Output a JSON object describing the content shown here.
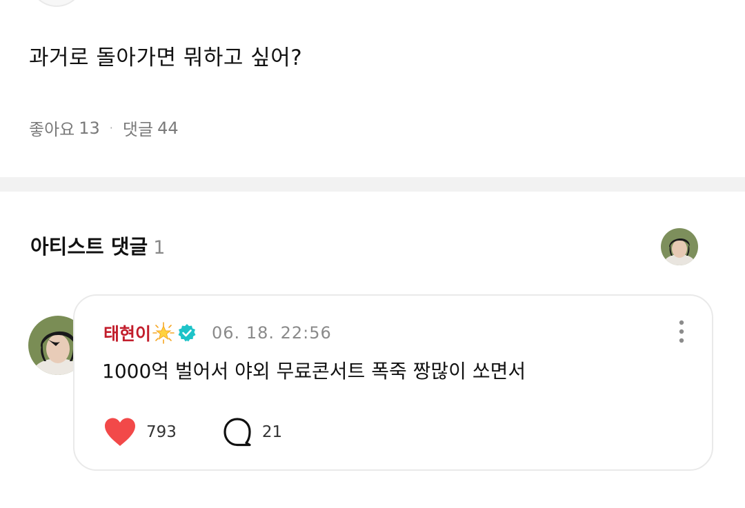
{
  "post": {
    "question": "과거로 돌아가면 뭐하고 싶어?",
    "likes_label": "좋아요",
    "likes_count": "13",
    "separator": "·",
    "comments_label": "댓글",
    "comments_count": "44"
  },
  "artist_section": {
    "title": "아티스트 댓글",
    "count": "1"
  },
  "comment": {
    "author": "태현이",
    "date": "06. 18. 22:56",
    "text": "1000억 벌어서 야외 무료콘서트 폭죽 짱많이 쏘면서",
    "likes": "793",
    "replies": "21",
    "like_color": "#f24949",
    "author_color": "#c21e2c",
    "verified_color": "#1ec3c8"
  },
  "icons": {
    "sparkle": "sparkle-star-icon",
    "verified": "verified-check-icon",
    "more": "more-vertical-icon",
    "heart": "heart-icon",
    "reply": "speech-bubble-icon"
  }
}
